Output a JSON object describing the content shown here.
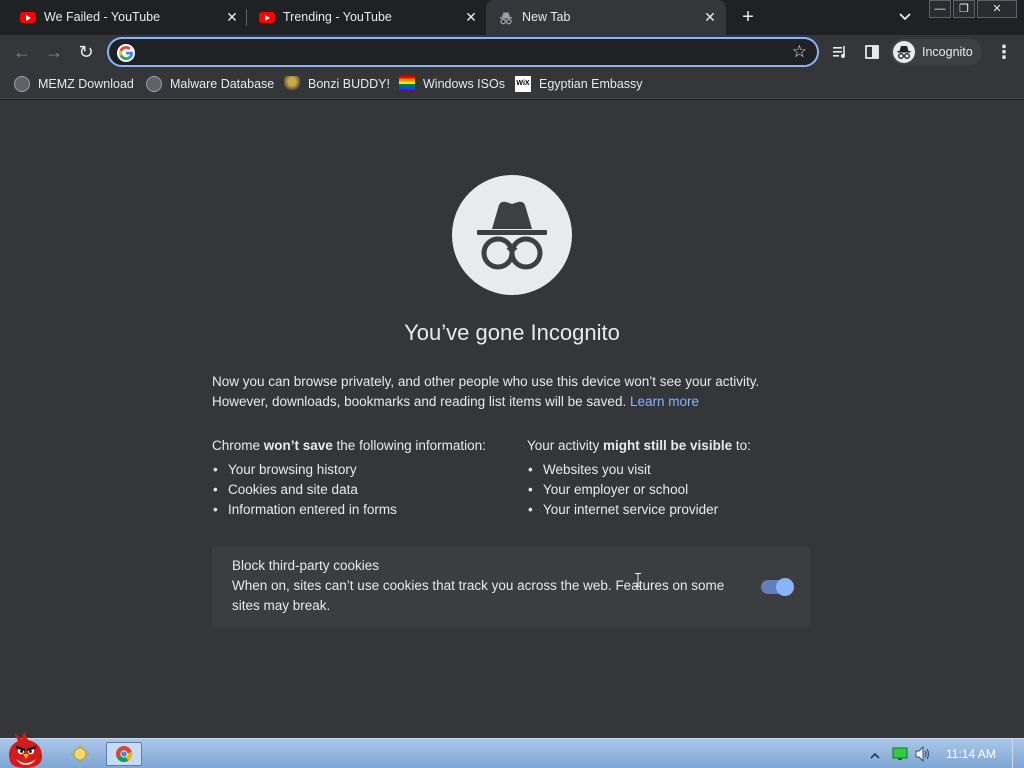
{
  "tabs": [
    {
      "title": "We Failed - YouTube",
      "favicon": "youtube-icon",
      "close": "✕"
    },
    {
      "title": "Trending - YouTube",
      "favicon": "youtube-icon",
      "close": "✕"
    },
    {
      "title": "New Tab",
      "favicon": "incognito-icon",
      "close": "✕",
      "active": true
    }
  ],
  "tabstrip": {
    "new_tab": "+",
    "tab_search": "⌄"
  },
  "window_controls": {
    "minimize": "—",
    "restore": "❐",
    "close": "✕"
  },
  "toolbar": {
    "back": "←",
    "forward": "→",
    "reload": "↻",
    "omnibox_value": "",
    "star": "☆",
    "profile_label": "Incognito",
    "menu": "⋮"
  },
  "bookmarks": [
    {
      "label": "MEMZ Download",
      "icon": "globe-icon"
    },
    {
      "label": "Malware Database",
      "icon": "globe-icon"
    },
    {
      "label": "Bonzi BUDDY!",
      "icon": "bonzi-icon"
    },
    {
      "label": "Windows ISOs",
      "icon": "rainbow-flag-icon"
    },
    {
      "label": "Egyptian Embassy",
      "icon": "wix-icon"
    }
  ],
  "bookmark_icon_text": {
    "wix": "WiX"
  },
  "content": {
    "heading": "You’ve gone Incognito",
    "intro_line1": "Now you can browse privately, and other people who use this device won’t see your activity.",
    "intro_line2": "However, downloads, bookmarks and reading list items will be saved.",
    "learn_more": "Learn more",
    "left_heading_pre": "Chrome ",
    "left_heading_bold": "won’t save",
    "left_heading_post": " the following information:",
    "left_items": [
      "Your browsing history",
      "Cookies and site data",
      "Information entered in forms"
    ],
    "right_heading_pre": "Your activity ",
    "right_heading_bold": "might still be visible",
    "right_heading_post": " to:",
    "right_items": [
      "Websites you visit",
      "Your employer or school",
      "Your internet service provider"
    ],
    "cookie_title": "Block third-party cookies",
    "cookie_desc": "When on, sites can’t use cookies that track you across the web. Features on some sites may break.",
    "cookie_toggle_on": true
  },
  "taskbar": {
    "clock": "11:14 AM"
  },
  "colors": {
    "accent": "#8ab4f8",
    "background": "#35363a",
    "tabstrip": "#202124"
  }
}
